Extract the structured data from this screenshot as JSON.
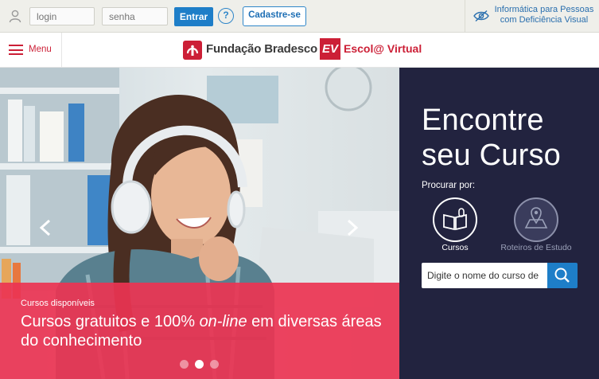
{
  "topbar": {
    "login_placeholder": "login",
    "password_placeholder": "senha",
    "enter_label": "Entrar",
    "help_label": "?",
    "register_label": "Cadastre-se",
    "accessibility_label": "Informática para Pessoas com Deficiência Visual"
  },
  "nav": {
    "menu_label": "Menu",
    "brand_fundacao": "Fundação Bradesco",
    "brand_ev_mark": "EV",
    "brand_escola": "Escol@ Virtual"
  },
  "hero": {
    "caption_small": "Cursos disponíveis",
    "caption_part1": "Cursos gratuitos e 100% ",
    "caption_italic": "on-line",
    "caption_part2": " em diversas áreas do conhecimento",
    "slides_total": 3,
    "slide_active": 2
  },
  "finder": {
    "title": "Encontre seu Curso",
    "search_by": "Procurar por:",
    "options": [
      {
        "label": "Cursos",
        "icon": "book-icon",
        "selected": true
      },
      {
        "label": "Roteiros de Estudo",
        "icon": "map-icon",
        "selected": false
      }
    ],
    "search_placeholder": "Digite o nome do curso de"
  },
  "colors": {
    "accent_red": "#cc1f36",
    "caption_pink": "#ec3452",
    "panel_navy": "#22233f",
    "button_blue": "#1e7ec8"
  }
}
